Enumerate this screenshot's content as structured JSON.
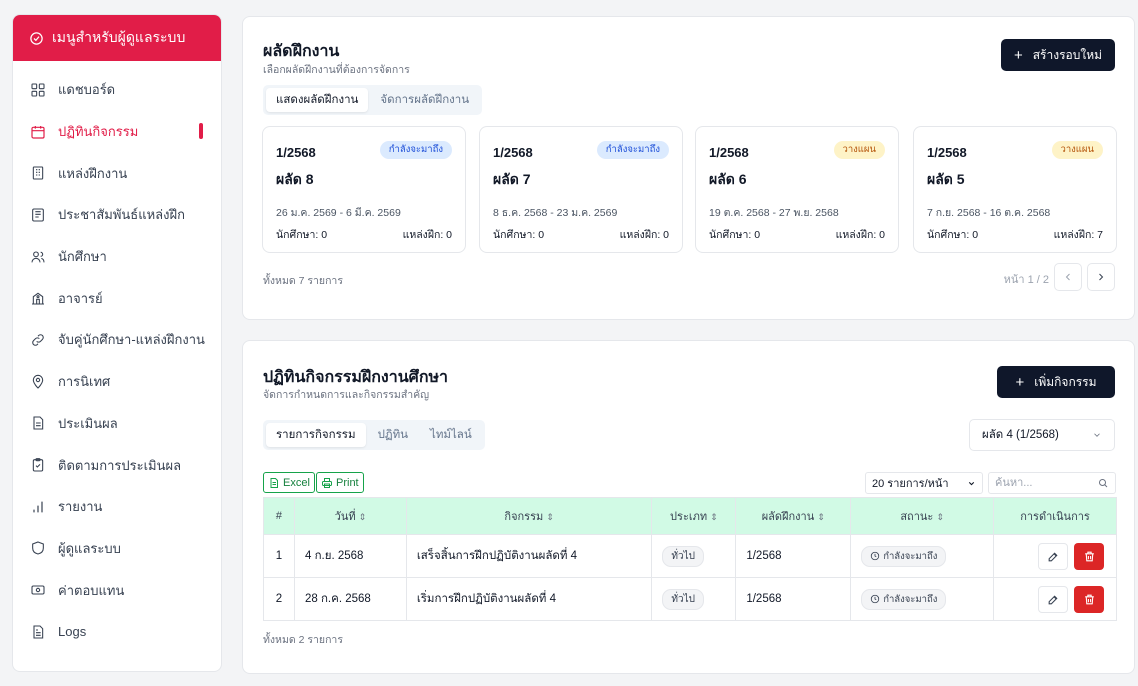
{
  "sidebar": {
    "title": "เมนูสำหรับผู้ดูแลระบบ",
    "items": [
      {
        "label": "แดชบอร์ด",
        "icon": "grid-icon"
      },
      {
        "label": "ปฏิทินกิจกรรม",
        "icon": "calendar-icon",
        "active": true
      },
      {
        "label": "แหล่งฝึกงาน",
        "icon": "building-icon"
      },
      {
        "label": "ประชาสัมพันธ์แหล่งฝึก",
        "icon": "newspaper-icon"
      },
      {
        "label": "นักศึกษา",
        "icon": "users-icon"
      },
      {
        "label": "อาจารย์",
        "icon": "school-icon"
      },
      {
        "label": "จับคู่นักศึกษา-แหล่งฝึกงาน",
        "icon": "link-icon"
      },
      {
        "label": "การนิเทศ",
        "icon": "location-pin-icon"
      },
      {
        "label": "ประเมินผล",
        "icon": "document-icon"
      },
      {
        "label": "ติดตามการประเมินผล",
        "icon": "clipboard-check-icon"
      },
      {
        "label": "รายงาน",
        "icon": "bar-chart-icon"
      },
      {
        "label": "ผู้ดูแลระบบ",
        "icon": "shield-icon"
      },
      {
        "label": "ค่าตอบแทน",
        "icon": "banknote-icon"
      },
      {
        "label": "Logs",
        "icon": "file-text-icon"
      }
    ]
  },
  "rounds_panel": {
    "title": "ผลัดฝึกงาน",
    "subtitle": "เลือกผลัดฝึกงานที่ต้องการจัดการ",
    "create_label": "สร้างรอบใหม่",
    "tabs": [
      {
        "label": "แสดงผลัดฝึกงาน",
        "active": true
      },
      {
        "label": "จัดการผลัดฝึกงาน",
        "active": false
      }
    ],
    "cards": [
      {
        "term": "1/2568",
        "name": "ผลัด 8",
        "badge": "กำลังจะมาถึง",
        "badge_type": "upcoming",
        "dates": "26 ม.ค. 2569 - 6 มี.ค. 2569",
        "students": "นักศึกษา: 0",
        "sites": "แหล่งฝึก: 0"
      },
      {
        "term": "1/2568",
        "name": "ผลัด 7",
        "badge": "กำลังจะมาถึง",
        "badge_type": "upcoming",
        "dates": "8 ธ.ค. 2568 - 23 ม.ค. 2569",
        "students": "นักศึกษา: 0",
        "sites": "แหล่งฝึก: 0"
      },
      {
        "term": "1/2568",
        "name": "ผลัด 6",
        "badge": "วางแผน",
        "badge_type": "plan",
        "dates": "19 ต.ค. 2568 - 27 พ.ย. 2568",
        "students": "นักศึกษา: 0",
        "sites": "แหล่งฝึก: 0"
      },
      {
        "term": "1/2568",
        "name": "ผลัด 5",
        "badge": "วางแผน",
        "badge_type": "plan",
        "dates": "7 ก.ย. 2568 - 16 ต.ค. 2568",
        "students": "นักศึกษา: 0",
        "sites": "แหล่งฝึก: 7"
      }
    ],
    "total_text": "ทั้งหมด 7 รายการ",
    "page_text": "หน้า 1 / 2"
  },
  "activities_panel": {
    "title": "ปฏิทินกิจกรรมฝึกงานศึกษา",
    "subtitle": "จัดการกำหนดการและกิจกรรมสำคัญ",
    "add_label": "เพิ่มกิจกรรม",
    "tabs": [
      {
        "label": "รายการกิจกรรม",
        "active": true
      },
      {
        "label": "ปฏิทิน",
        "active": false
      },
      {
        "label": "ไทม์ไลน์",
        "active": false
      }
    ],
    "round_select": "ผลัด 4 (1/2568)",
    "excel_label": "Excel",
    "print_label": "Print",
    "per_page": "20 รายการ/หน้า",
    "search_placeholder": "ค้นหา...",
    "columns": [
      "#",
      "วันที่",
      "กิจกรรม",
      "ประเภท",
      "ผลัดฝึกงาน",
      "สถานะ",
      "การดำเนินการ"
    ],
    "rows": [
      {
        "no": "1",
        "date": "4 ก.ย. 2568",
        "activity": "เสร็จสิ้นการฝึกปฏิบัติงานผลัดที่ 4",
        "type": "ทั่วไป",
        "round": "1/2568",
        "status": "กำลังจะมาถึง"
      },
      {
        "no": "2",
        "date": "28 ก.ค. 2568",
        "activity": "เริ่มการฝึกปฏิบัติงานผลัดที่ 4",
        "type": "ทั่วไป",
        "round": "1/2568",
        "status": "กำลังจะมาถึง"
      }
    ],
    "total_text": "ทั้งหมด 2 รายการ"
  },
  "colors": {
    "accent": "#e11d48",
    "dark_button": "#0f172a",
    "table_header": "#d1fae5",
    "delete": "#dc2626",
    "excel_green": "#16a34a"
  }
}
